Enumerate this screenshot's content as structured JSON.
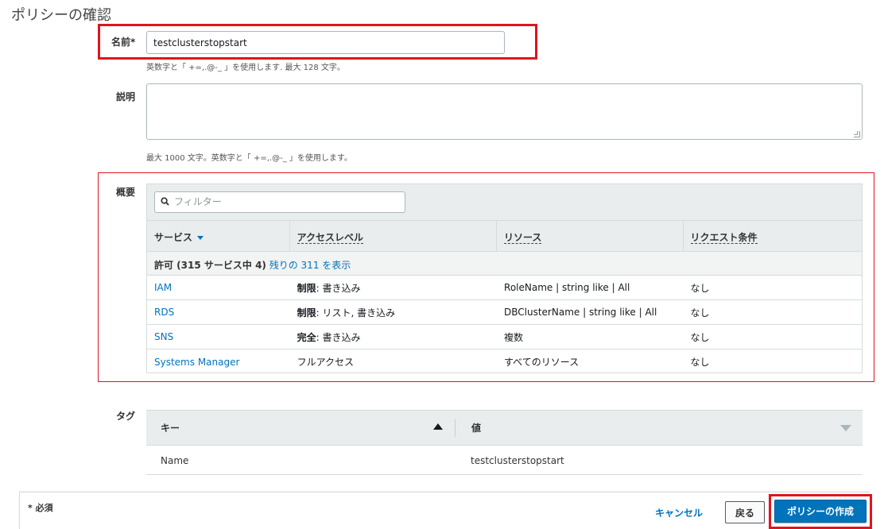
{
  "page": {
    "title": "ポリシーの確認"
  },
  "name_field": {
    "label": "名前*",
    "value": "testclusterstopstart",
    "hint": "英数字と「 +=,.@-_ 」を使用します. 最大 128 文字。"
  },
  "description_field": {
    "label": "説明",
    "value": "",
    "hint": "最大 1000 文字。英数字と「 +=,.@-_ 」を使用します。"
  },
  "summary": {
    "label": "概要",
    "filter_placeholder": "フィルター",
    "columns": [
      "サービス",
      "アクセスレベル",
      "リソース",
      "リクエスト条件"
    ],
    "group": {
      "label": "許可 (315 サービス中 4)",
      "link": "残りの 311 を表示"
    },
    "rows": [
      {
        "service": "IAM",
        "access_bold": "制限",
        "access_rest": ": 書き込み",
        "resource": "RoleName | string like | All",
        "condition": "なし"
      },
      {
        "service": "RDS",
        "access_bold": "制限",
        "access_rest": ": リスト, 書き込み",
        "resource": "DBClusterName | string like | All",
        "condition": "なし"
      },
      {
        "service": "SNS",
        "access_bold": "完全",
        "access_rest": ": 書き込み",
        "resource": "複数",
        "condition": "なし"
      },
      {
        "service": "Systems Manager",
        "access_bold": "",
        "access_rest": "フルアクセス",
        "resource": "すべてのリソース",
        "condition": "なし"
      }
    ]
  },
  "tags": {
    "label": "タグ",
    "columns": [
      "キー",
      "値"
    ],
    "rows": [
      {
        "key": "Name",
        "value": "testclusterstopstart"
      }
    ]
  },
  "footer": {
    "required_note": "* 必須",
    "cancel_label": "キャンセル",
    "back_label": "戻る",
    "create_label": "ポリシーの作成"
  },
  "colors": {
    "highlight_red": "#e0141e",
    "link_blue": "#0073bb",
    "primary_button": "#0073bb"
  }
}
